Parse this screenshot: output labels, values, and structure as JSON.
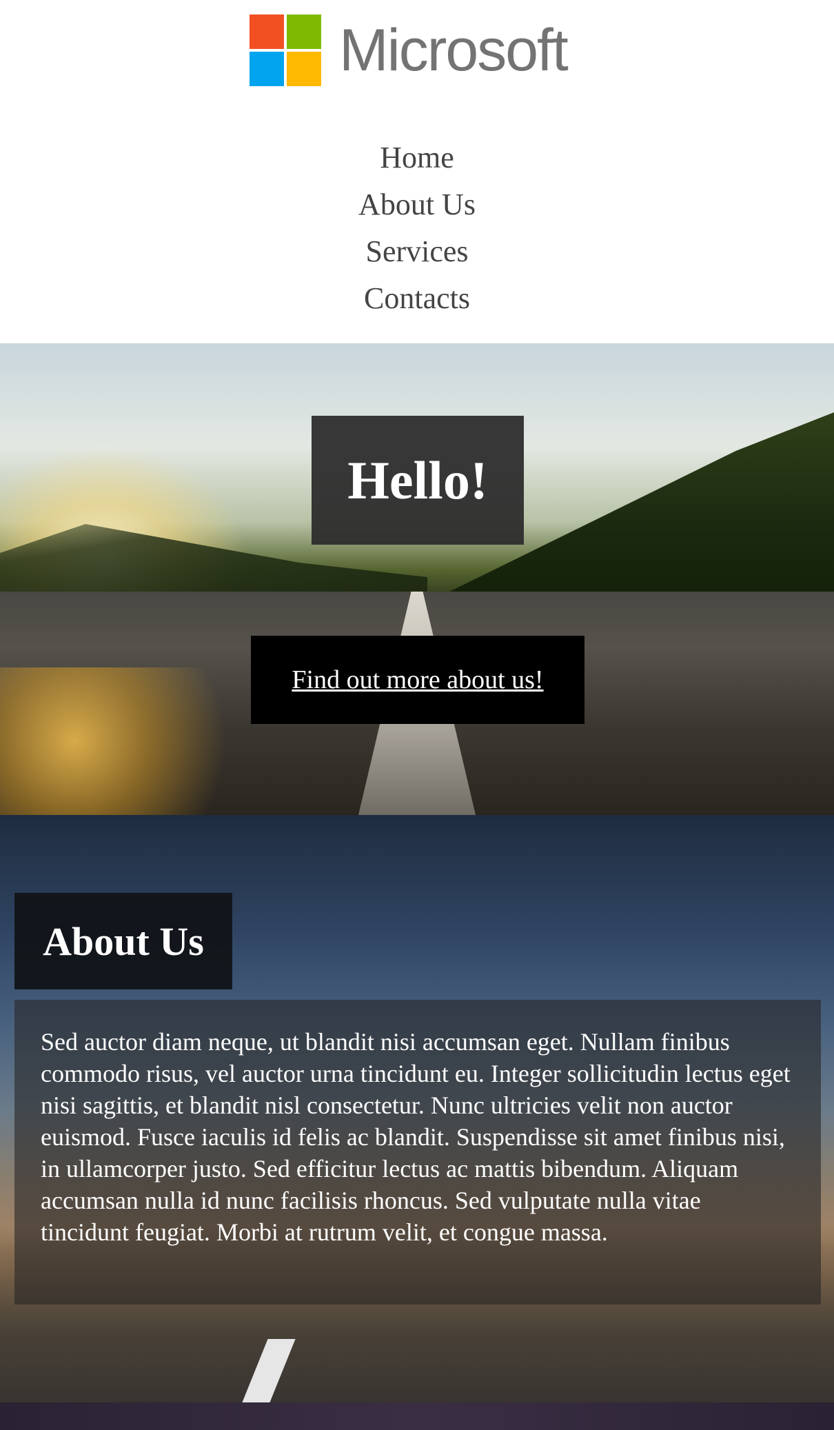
{
  "header": {
    "logo": {
      "wordmark": "Microsoft",
      "colors": [
        "#f25022",
        "#7fba00",
        "#00a4ef",
        "#ffb900"
      ]
    },
    "nav": [
      {
        "label": "Home"
      },
      {
        "label": "About Us"
      },
      {
        "label": "Services"
      },
      {
        "label": "Contacts"
      }
    ]
  },
  "hero": {
    "heading": "Hello!",
    "cta_label": "Find out more about us!"
  },
  "about": {
    "title": "About Us",
    "body": "Sed auctor diam neque, ut blandit nisi accumsan eget. Nullam finibus commodo risus, vel auctor urna tincidunt eu. Integer sollicitudin lectus eget nisi sagittis, et blandit nisl consectetur. Nunc ultricies velit non auctor euismod. Fusce iaculis id felis ac blandit. Suspendisse sit amet finibus nisi, in ullamcorper justo. Sed efficitur lectus ac mattis bibendum. Aliquam accumsan nulla id nunc facilisis rhoncus. Sed vulputate nulla vitae tincidunt feugiat. Morbi at rutrum velit, et congue massa."
  }
}
